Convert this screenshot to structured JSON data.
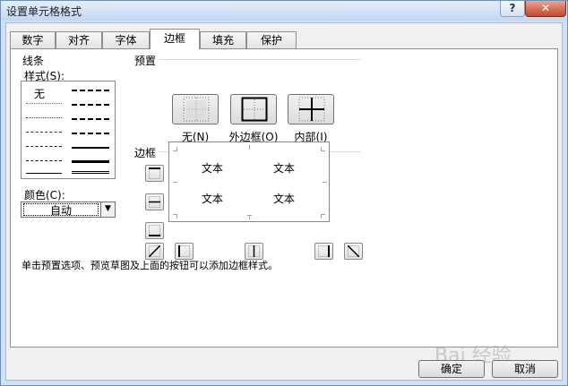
{
  "window": {
    "title": "设置单元格格式",
    "help_icon": "?",
    "close_icon": "✕"
  },
  "tabs": [
    {
      "label": "数字"
    },
    {
      "label": "对齐"
    },
    {
      "label": "字体"
    },
    {
      "label": "边框",
      "active": true
    },
    {
      "label": "填充"
    },
    {
      "label": "保护"
    }
  ],
  "line": {
    "group_label": "线条",
    "style_label": "样式(S):",
    "none_label": "无",
    "color_label": "颜色(C):",
    "color_value": "自动"
  },
  "presets": {
    "group_label": "预置",
    "items": [
      {
        "label": "无(N)"
      },
      {
        "label": "外边框(O)"
      },
      {
        "label": "内部(I)"
      }
    ]
  },
  "border": {
    "group_label": "边框",
    "preview_text": "文本"
  },
  "hint": "单击预置选项、预览草图及上面的按钮可以添加边框样式。",
  "buttons": {
    "ok": "确定",
    "cancel": "取消"
  },
  "watermark": "Bai 经验"
}
